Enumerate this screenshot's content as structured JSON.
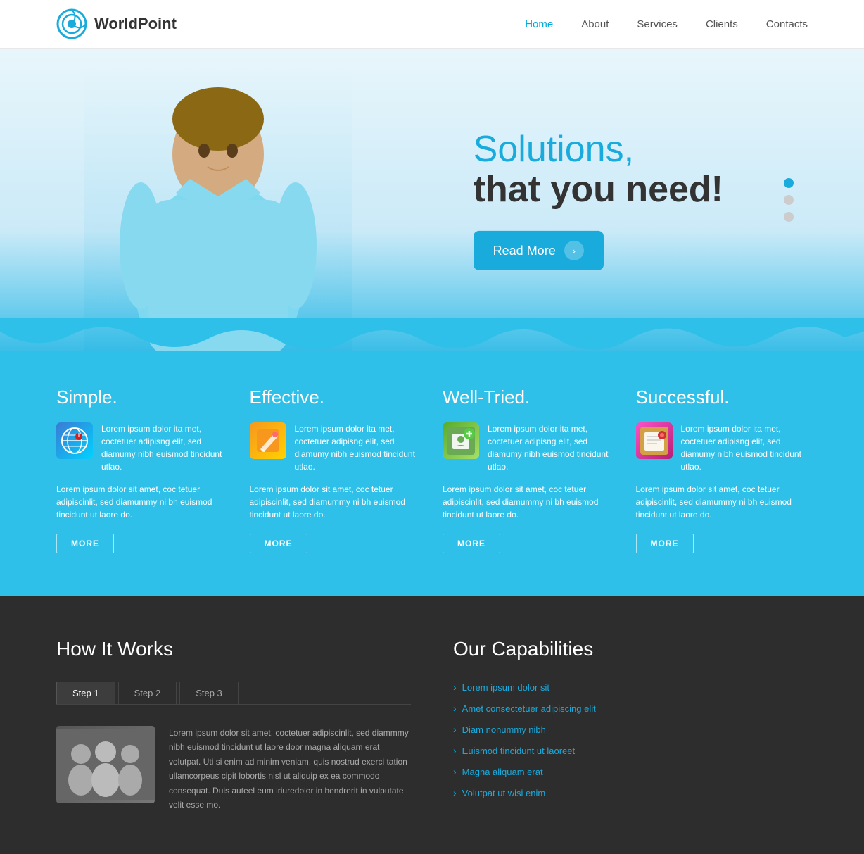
{
  "header": {
    "logo_text": "WorldPoint",
    "nav": {
      "home": "Home",
      "about": "About",
      "services": "Services",
      "clients": "Clients",
      "contacts": "Contacts"
    }
  },
  "hero": {
    "title_line1": "Solutions,",
    "title_line2": "that you need!",
    "cta_label": "Read More"
  },
  "features": [
    {
      "title": "Simple.",
      "body_text": "Lorem ipsum dolor ita met, coctetuer adipisng elit, sed diamumy nibh euismod tincidunt utlao.",
      "full_text": "Lorem ipsum dolor sit amet, coc tetuer adipiscinlit, sed diamummy ni bh euismod tincidunt ut laore do.",
      "more_label": "MORE"
    },
    {
      "title": "Effective.",
      "body_text": "Lorem ipsum dolor ita met, coctetuer adipisng elit, sed diamumy nibh euismod tincidunt utlao.",
      "full_text": "Lorem ipsum dolor sit amet, coc tetuer adipiscinlit, sed diamummy ni bh euismod tincidunt ut laore do.",
      "more_label": "MORE"
    },
    {
      "title": "Well-Tried.",
      "body_text": "Lorem ipsum dolor ita met, coctetuer adipisng elit, sed diamumy nibh euismod tincidunt utlao.",
      "full_text": "Lorem ipsum dolor sit amet, coc tetuer adipiscinlit, sed diamummy ni bh euismod tincidunt ut laore do.",
      "more_label": "MORE"
    },
    {
      "title": "Successful.",
      "body_text": "Lorem ipsum dolor ita met, coctetuer adipisng elit, sed diamumy nibh euismod tincidunt utlao.",
      "full_text": "Lorem ipsum dolor sit amet, coc tetuer adipiscinlit, sed diamummy ni bh euismod tincidunt ut laore do.",
      "more_label": "MORE"
    }
  ],
  "how_it_works": {
    "title": "How It Works",
    "tabs": [
      "Step 1",
      "Step 2",
      "Step 3"
    ],
    "active_tab": 0,
    "step_description": "Lorem ipsum dolor sit amet, coctetuer adipiscinlit, sed diammmy nibh euismod tincidunt ut laore door magna aliquam erat volutpat. Uti si enim ad minim veniam, quis nostrud exerci tation ullamcorpeus cipit lobortis nisl ut aliquip ex ea commodo consequat. Duis auteel eum iriuredolor in hendrerit in vulputate velit esse mo."
  },
  "capabilities": {
    "title": "Our Capabilities",
    "links": [
      "Lorem ipsum dolor sit",
      "Amet consectetuer adipiscing elit",
      "Diam nonummy nibh",
      "Euismod tincidunt ut laoreet",
      "Magna aliquam erat",
      "Volutpat ut wisi enim"
    ]
  }
}
